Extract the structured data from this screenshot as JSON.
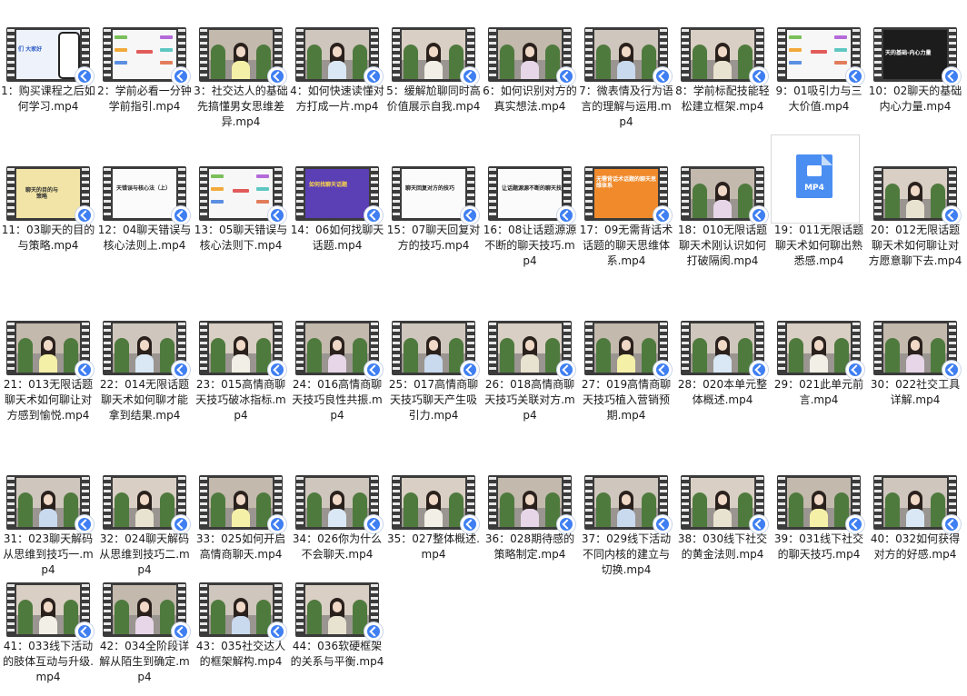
{
  "colors": {
    "film": "#3b3b3b",
    "shortcut_arrow": "#3f7ff2",
    "file_icon": "#4a8ef2"
  },
  "files": [
    {
      "label": "1：购买课程之后如何学习.mp4",
      "thumb": "phone",
      "slide_text": "们 大家好"
    },
    {
      "label": "2：学前必看一分钟学前指引.mp4",
      "thumb": "mindmap"
    },
    {
      "label": "3：社交达人的基础先搞懂男女思维差异.mp4",
      "thumb": "person"
    },
    {
      "label": "4：如何快速读懂对方打成一片.mp4",
      "thumb": "person"
    },
    {
      "label": "5：缓解尬聊同时高价值展示自我.mp4",
      "thumb": "person"
    },
    {
      "label": "6：如何识别对方的真实想法.mp4",
      "thumb": "person"
    },
    {
      "label": "7：微表情及行为语言的理解与运用.mp4",
      "thumb": "person"
    },
    {
      "label": "8：学前标配技能轻松建立框架.mp4",
      "thumb": "person"
    },
    {
      "label": "9：01吸引力与三大价值.mp4",
      "thumb": "mindmap"
    },
    {
      "label": "10：02聊天的基础内心力量.mp4",
      "thumb": "dark",
      "slide_text": "天的基础-内心力量"
    },
    {
      "label": "11：03聊天的目的与策略.mp4",
      "thumb": "yellowcard",
      "slide_text": "聊天的目的与策略"
    },
    {
      "label": "12：04聊天错误与核心法则上.mp4",
      "thumb": "slide",
      "slide_text": "天错误与核心法（上）"
    },
    {
      "label": "13：05聊天错误与核心法则下.mp4",
      "thumb": "mindmap"
    },
    {
      "label": "14：06如何找聊天话题.mp4",
      "thumb": "purple",
      "slide_text": "如何找聊天话题"
    },
    {
      "label": "15：07聊天回复对方的技巧.mp4",
      "thumb": "slide",
      "slide_text": "聊天回复对方的技巧"
    },
    {
      "label": "16：08让话题源源不断的聊天技巧.mp4",
      "thumb": "slide",
      "slide_text": "让话题源源不断的聊天技巧"
    },
    {
      "label": "17：09无需背话术话题的聊天思维体系.mp4",
      "thumb": "orange",
      "slide_text": "无需背话术话题的聊天思维体系"
    },
    {
      "label": "18：010无限话题聊天术刚认识如何打破隔阂.mp4",
      "thumb": "person"
    },
    {
      "label": "19：011无限话题聊天术如何聊出熟悉感.mp4",
      "thumb": "fileicon",
      "icon_text": "MP4"
    },
    {
      "label": "20：012无限话题聊天术如何聊让对方愿意聊下去.mp4",
      "thumb": "person"
    },
    {
      "label": "21：013无限话题聊天术如何聊让对方感到愉悦.mp4",
      "thumb": "person"
    },
    {
      "label": "22：014无限话题聊天术如何聊才能拿到结果.mp4",
      "thumb": "person"
    },
    {
      "label": "23：015高情商聊天技巧破冰指标.mp4",
      "thumb": "person"
    },
    {
      "label": "24：016高情商聊天技巧良性共振.mp4",
      "thumb": "person"
    },
    {
      "label": "25：017高情商聊天技巧聊天产生吸引力.mp4",
      "thumb": "person"
    },
    {
      "label": "26：018高情商聊天技巧关联对方.mp4",
      "thumb": "person"
    },
    {
      "label": "27：019高情商聊天技巧植入营销预期.mp4",
      "thumb": "person"
    },
    {
      "label": "28：020本单元整体概述.mp4",
      "thumb": "person"
    },
    {
      "label": "29：021此单元前言.mp4",
      "thumb": "person"
    },
    {
      "label": "30：022社交工具详解.mp4",
      "thumb": "person"
    },
    {
      "label": "31：023聊天解码从思维到技巧一.mp4",
      "thumb": "person"
    },
    {
      "label": "32：024聊天解码从思维到技巧二.mp4",
      "thumb": "person"
    },
    {
      "label": "33：025如何开启高情商聊天.mp4",
      "thumb": "person"
    },
    {
      "label": "34：026你为什么不会聊天.mp4",
      "thumb": "person"
    },
    {
      "label": "35：027整体概述.mp4",
      "thumb": "person"
    },
    {
      "label": "36：028期待感的策略制定.mp4",
      "thumb": "person"
    },
    {
      "label": "37：029线下活动不同内核的建立与切换.mp4",
      "thumb": "person"
    },
    {
      "label": "38：030线下社交的黄金法则.mp4",
      "thumb": "person"
    },
    {
      "label": "39：031线下社交的聊天技巧.mp4",
      "thumb": "person"
    },
    {
      "label": "40：032如何获得对方的好感.mp4",
      "thumb": "person"
    },
    {
      "label": "41：033线下活动的肢体互动与升级.mp4",
      "thumb": "person"
    },
    {
      "label": "42：034全阶段详解从陌生到确定.mp4",
      "thumb": "person"
    },
    {
      "label": "43：035社交达人的框架解构.mp4",
      "thumb": "person"
    },
    {
      "label": "44：036软硬框架的关系与平衡.mp4",
      "thumb": "person"
    }
  ]
}
